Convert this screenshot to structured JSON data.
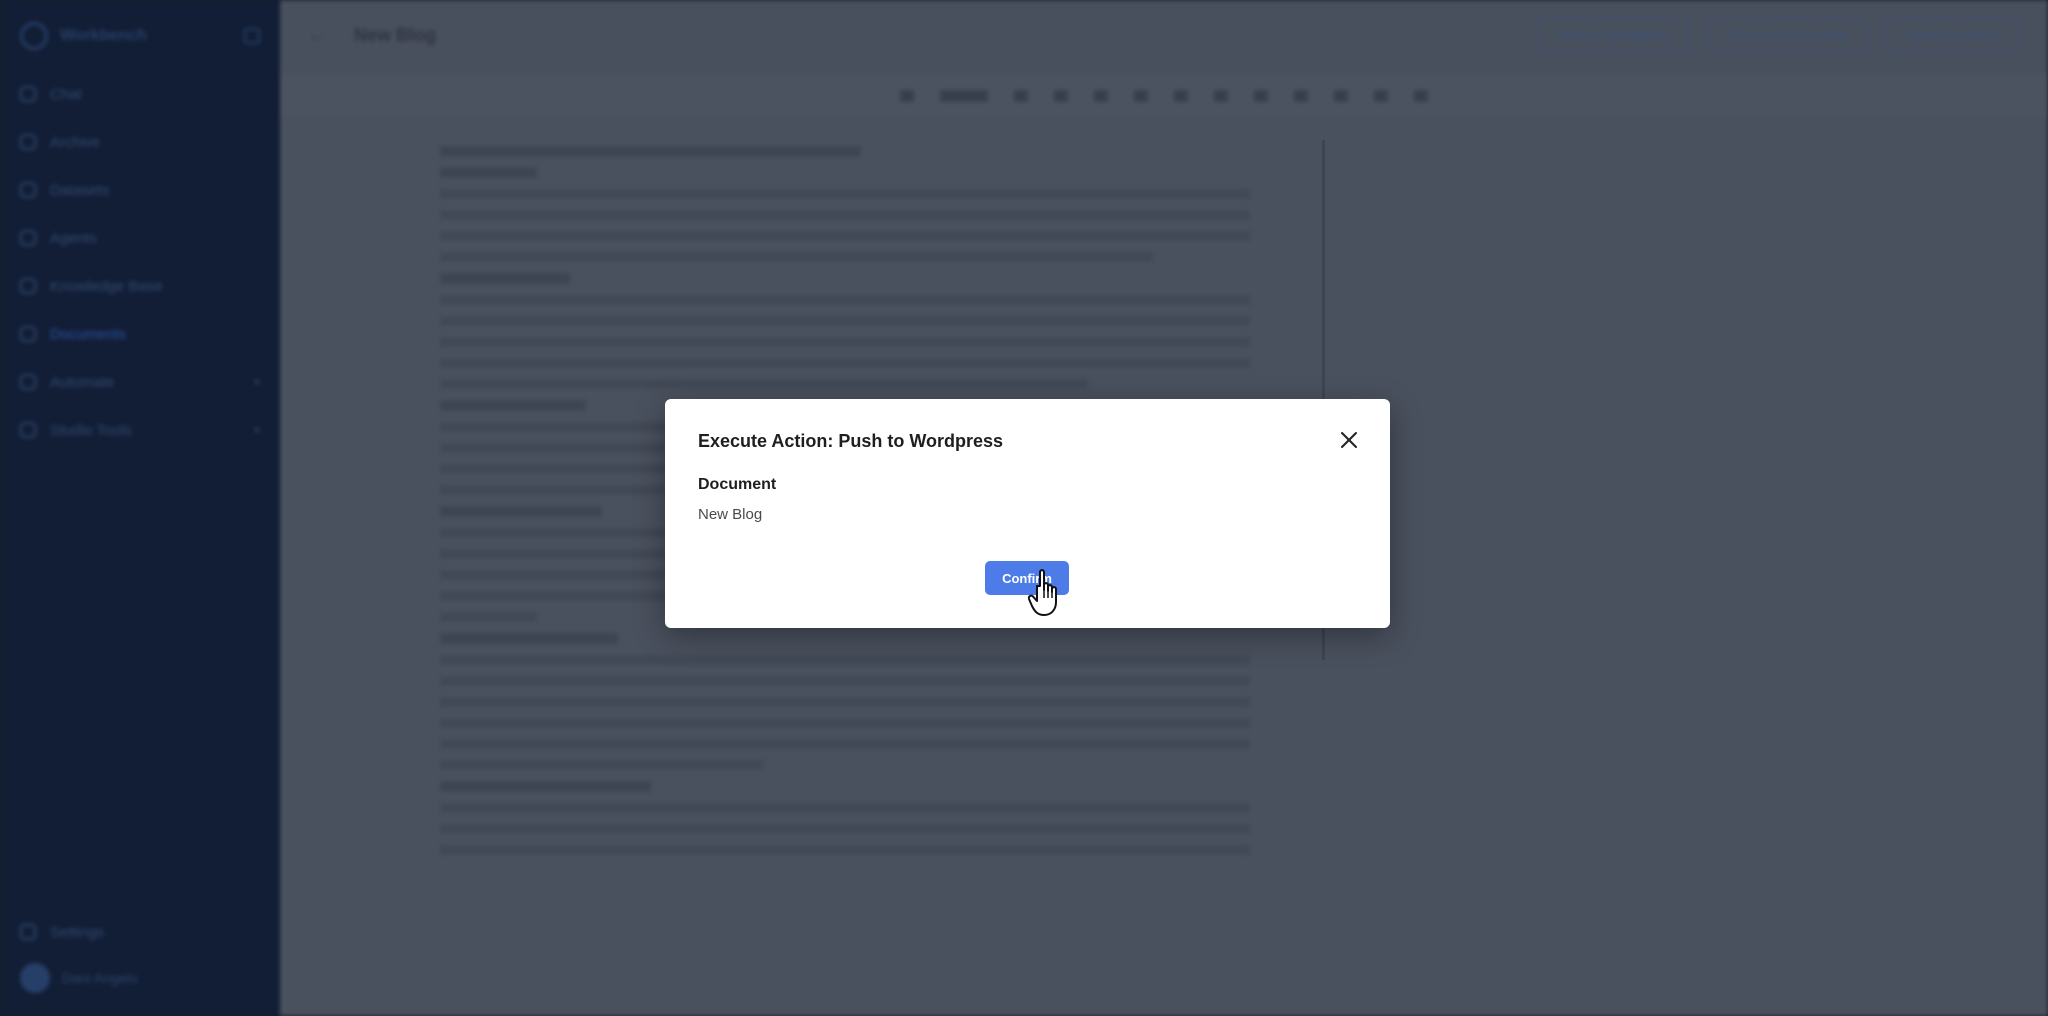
{
  "sidebar": {
    "brand": "Workbench",
    "items": [
      {
        "label": "Chat"
      },
      {
        "label": "Archive"
      },
      {
        "label": "Datasets"
      },
      {
        "label": "Agents"
      },
      {
        "label": "Knowledge Base"
      },
      {
        "label": "Documents"
      },
      {
        "label": "Automate"
      },
      {
        "label": "Studio Tools"
      }
    ],
    "settings_label": "Settings",
    "user_name": "Dani Angelo"
  },
  "topbar": {
    "doc_title": "New Blog",
    "actions": [
      {
        "label": "Push to Wordpress"
      },
      {
        "label": "Export as Document"
      },
      {
        "label": "Save Document"
      }
    ]
  },
  "modal": {
    "title": "Execute Action: Push to Wordpress",
    "field_label": "Document",
    "field_value": "New Blog",
    "confirm_label": "Confirm"
  },
  "icons": {
    "close": "close-icon",
    "cursor": "hand-pointer-icon"
  },
  "colors": {
    "primary": "#4d7be8",
    "sidebar_bg": "#14213c"
  }
}
